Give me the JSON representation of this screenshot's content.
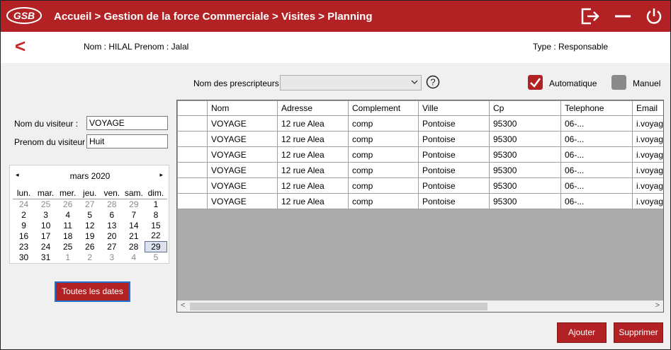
{
  "app": {
    "logo_text": "GSB",
    "breadcrumb": "Accueil > Gestion de la force Commerciale > Visites > Planning",
    "icons": [
      "logout-icon",
      "minimize-icon",
      "power-icon"
    ]
  },
  "info": {
    "back_label": "<",
    "user": "Nom : HILAL  Prenom : Jalal",
    "type": "Type : Responsable"
  },
  "filters": {
    "prescripteurs_label": "Nom des prescripteurs :",
    "prescripteurs_value": "",
    "help_label": "?",
    "automatique_label": "Automatique",
    "automatique_checked": true,
    "manuel_label": "Manuel",
    "manuel_checked": false
  },
  "visitor": {
    "nom_label": "Nom du visiteur :",
    "nom_value": "VOYAGE",
    "prenom_label": "Prenom du visiteur :",
    "prenom_value": "Huit"
  },
  "calendar": {
    "month": "mars 2020",
    "prev": "◂",
    "next": "▸",
    "days": [
      "lun.",
      "mar.",
      "mer.",
      "jeu.",
      "ven.",
      "sam.",
      "dim."
    ],
    "weeks": [
      [
        "24",
        "25",
        "26",
        "27",
        "28",
        "29",
        "1"
      ],
      [
        "2",
        "3",
        "4",
        "5",
        "6",
        "7",
        "8"
      ],
      [
        "9",
        "10",
        "11",
        "12",
        "13",
        "14",
        "15"
      ],
      [
        "16",
        "17",
        "18",
        "19",
        "20",
        "21",
        "22"
      ],
      [
        "23",
        "24",
        "25",
        "26",
        "27",
        "28",
        "29"
      ],
      [
        "30",
        "31",
        "1",
        "2",
        "3",
        "4",
        "5"
      ]
    ],
    "selected_day": "29"
  },
  "buttons": {
    "toutes_dates": "Toutes les dates",
    "ajouter": "Ajouter",
    "supprimer": "Supprimer"
  },
  "grid": {
    "columns": [
      "Nom",
      "Adresse",
      "Complement",
      "Ville",
      "Cp",
      "Telephone",
      "Email"
    ],
    "rows": [
      [
        "VOYAGE",
        "12 rue Alea",
        "comp",
        "Pontoise",
        "95300",
        "06-...",
        "i.voyage"
      ],
      [
        "VOYAGE",
        "12 rue Alea",
        "comp",
        "Pontoise",
        "95300",
        "06-...",
        "i.voyage"
      ],
      [
        "VOYAGE",
        "12 rue Alea",
        "comp",
        "Pontoise",
        "95300",
        "06-...",
        "i.voyage"
      ],
      [
        "VOYAGE",
        "12 rue Alea",
        "comp",
        "Pontoise",
        "95300",
        "06-...",
        "i.voyage"
      ],
      [
        "VOYAGE",
        "12 rue Alea",
        "comp",
        "Pontoise",
        "95300",
        "06-...",
        "i.voyage"
      ],
      [
        "VOYAGE",
        "12 rue Alea",
        "comp",
        "Pontoise",
        "95300",
        "06-...",
        "i.voyage"
      ]
    ],
    "scroll_left": "<",
    "scroll_right": ">"
  },
  "colors": {
    "brand": "#b22224",
    "grid_background": "#ababab"
  }
}
